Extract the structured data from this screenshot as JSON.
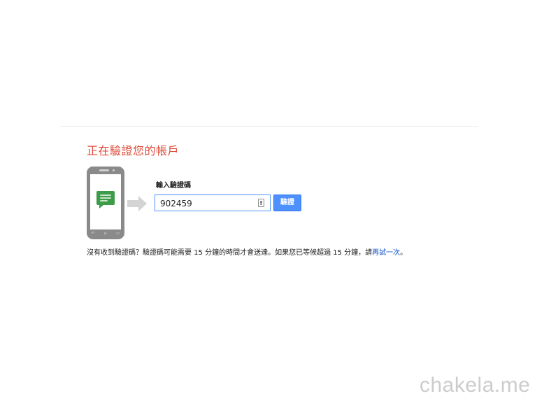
{
  "page": {
    "title": "正在驗證您的帳戶"
  },
  "form": {
    "label": "輸入驗證碼",
    "code_value": "902459",
    "verify_button_label": "驗證"
  },
  "help": {
    "text_before": "沒有收到驗證碼？驗證碼可能需要 15 分鐘的時間才會送達。如果您已等候超過 15 分鐘，請",
    "retry_link": "再試一次",
    "text_after": "。"
  },
  "watermark": "chakela.me",
  "icons": {
    "phone": "phone-icon",
    "message": "message-bubble-icon",
    "arrow": "arrow-right-icon",
    "keypad": "keypad-icon"
  },
  "colors": {
    "title": "#dd4b39",
    "accent": "#4d90fe",
    "link": "#1155cc",
    "message_bubble": "#3d9c49"
  }
}
